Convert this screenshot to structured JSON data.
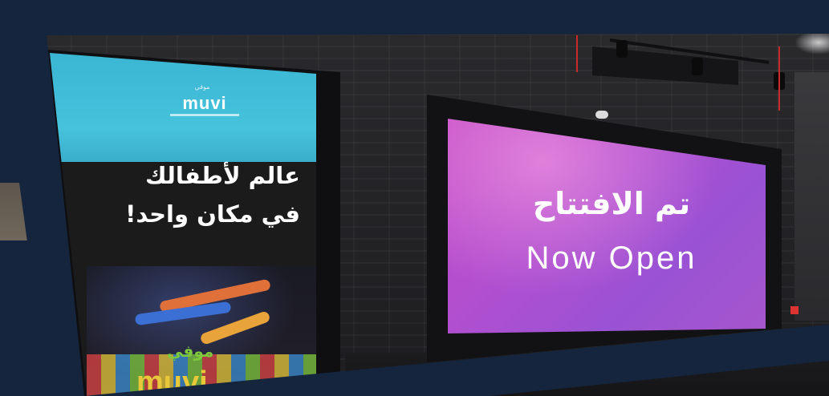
{
  "poster": {
    "brand_small": "موفي",
    "brand": "muvi",
    "headline_ar_1": "عالم لأطفالك",
    "headline_ar_2": "في مكان واحد!",
    "logo_ar": "موفي",
    "logo_en": "muvi"
  },
  "sign": {
    "title_ar": "تم الافتتاح",
    "title_en": "Now Open"
  },
  "colors": {
    "frame_navy": "#14253d",
    "poster_cyan": "#46c2dc",
    "sign_magenta": "#b04fd0"
  }
}
